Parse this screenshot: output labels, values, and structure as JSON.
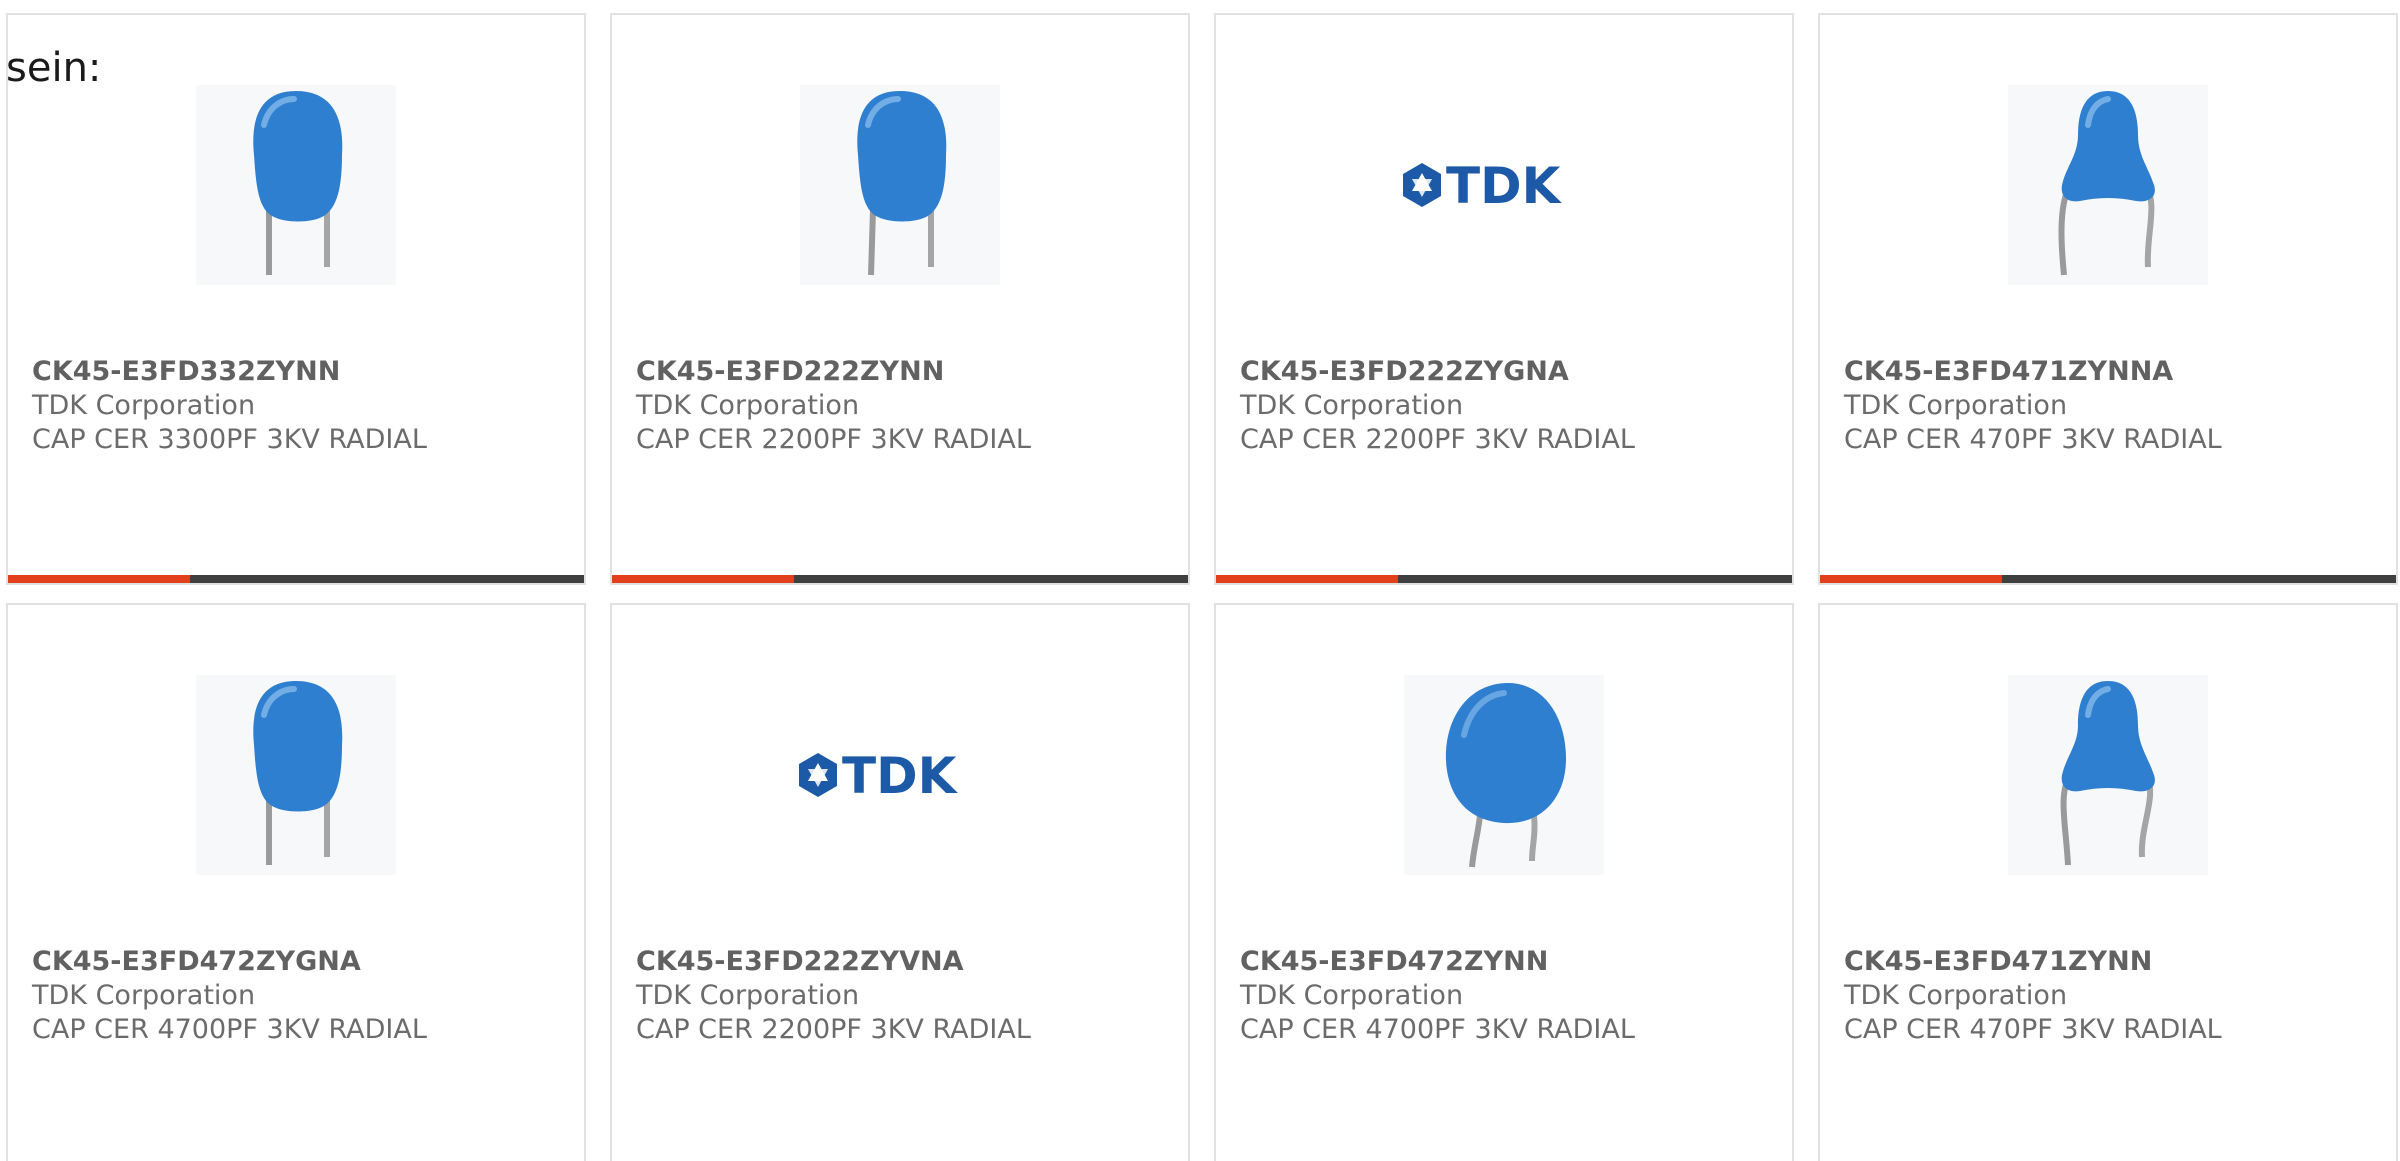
{
  "intro_text": "sein:",
  "colors": {
    "capacitor_blue": "#2f7fd0",
    "lead_gray": "#9a9a9a",
    "accent_red": "#e2401c",
    "bar_dark": "#3f3f3f",
    "tdk_blue": "#1c5aa8"
  },
  "products": [
    {
      "part_number": "CK45-E3FD332ZYNN",
      "manufacturer": "TDK Corporation",
      "description": "CAP CER 3300PF 3KV RADIAL",
      "image": "capacitor-image",
      "logo_text": ""
    },
    {
      "part_number": "CK45-E3FD222ZYNN",
      "manufacturer": "TDK Corporation",
      "description": "CAP CER 2200PF 3KV RADIAL",
      "image": "capacitor-image",
      "logo_text": ""
    },
    {
      "part_number": "CK45-E3FD222ZYGNA",
      "manufacturer": "TDK Corporation",
      "description": "CAP CER 2200PF 3KV RADIAL",
      "image": "tdk-logo",
      "logo_text": "TDK"
    },
    {
      "part_number": "CK45-E3FD471ZYNNA",
      "manufacturer": "TDK Corporation",
      "description": "CAP CER 470PF 3KV RADIAL",
      "image": "capacitor-bent-leads-image",
      "logo_text": ""
    },
    {
      "part_number": "CK45-E3FD472ZYGNA",
      "manufacturer": "TDK Corporation",
      "description": "CAP CER 4700PF 3KV RADIAL",
      "image": "capacitor-image",
      "logo_text": ""
    },
    {
      "part_number": "CK45-E3FD222ZYVNA",
      "manufacturer": "TDK Corporation",
      "description": "CAP CER 2200PF 3KV RADIAL",
      "image": "tdk-logo",
      "logo_text": "TDK"
    },
    {
      "part_number": "CK45-E3FD472ZYNN",
      "manufacturer": "TDK Corporation",
      "description": "CAP CER 4700PF 3KV RADIAL",
      "image": "capacitor-round-image",
      "logo_text": ""
    },
    {
      "part_number": "CK45-E3FD471ZYNN",
      "manufacturer": "TDK Corporation",
      "description": "CAP CER 470PF 3KV RADIAL",
      "image": "capacitor-bent-leads-image",
      "logo_text": ""
    }
  ]
}
